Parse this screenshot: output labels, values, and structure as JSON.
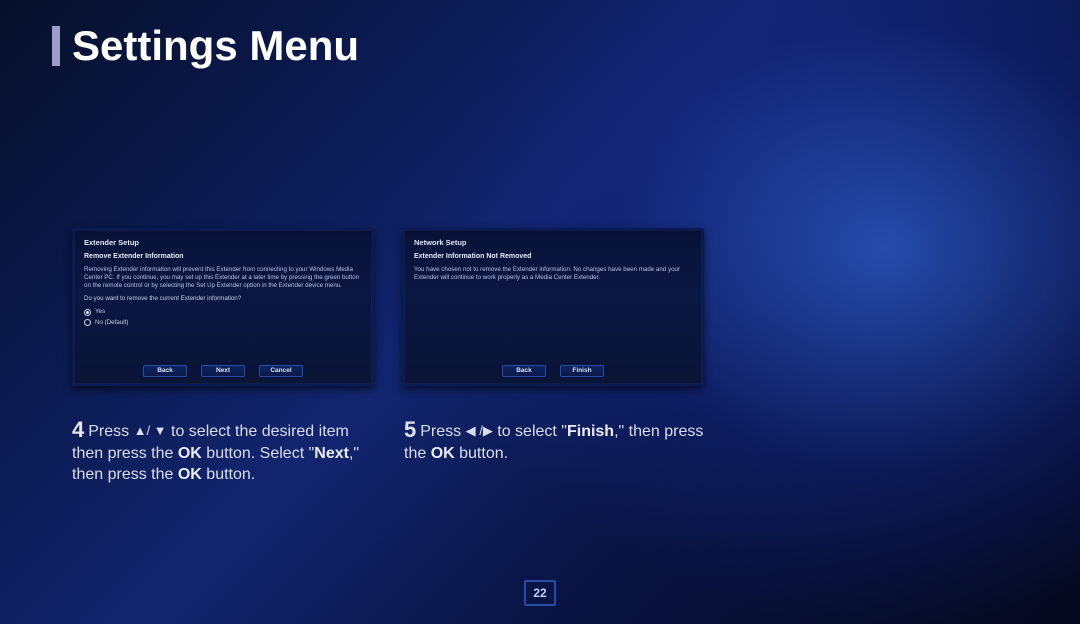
{
  "title": "Settings Menu",
  "page_number": "22",
  "panels": [
    {
      "title": "Extender Setup",
      "subtitle": "Remove Extender Information",
      "body": "Removing Extender information will prevent this Extender from connecting to your Windows Media Center PC. If you continue, you may set up this Extender at a later time by pressing the green button on the remote control or by selecting the Set Up Extender option in the Extender device menu.",
      "question": "Do you want to remove the current Extender information?",
      "options": [
        {
          "label": "Yes",
          "selected": true
        },
        {
          "label": "No (Default)",
          "selected": false
        }
      ],
      "buttons": [
        "Back",
        "Next",
        "Cancel"
      ]
    },
    {
      "title": "Network Setup",
      "subtitle": "Extender Information Not Removed",
      "body": "You have chosen not to remove the Extender information. No changes have been made and your Extender will continue to work properly as a Media Center Extender.",
      "question": "",
      "options": [],
      "buttons": [
        "Back",
        "Finish"
      ]
    }
  ],
  "steps": [
    {
      "num": "4",
      "pre": "Press ",
      "arrows": "▲/ ▼",
      "mid1": " to select the desired item then press the ",
      "ok1": "OK",
      "mid2": " button. Select \"",
      "next": "Next",
      "mid3": ",\" then press the ",
      "ok2": "OK",
      "tail": " button."
    },
    {
      "num": "5",
      "pre": "Press ",
      "arrows": "◀ /▶",
      "mid1": " to select \"",
      "finish": "Finish",
      "mid2": ",\" then press the ",
      "ok1": "OK",
      "tail": " button."
    }
  ]
}
